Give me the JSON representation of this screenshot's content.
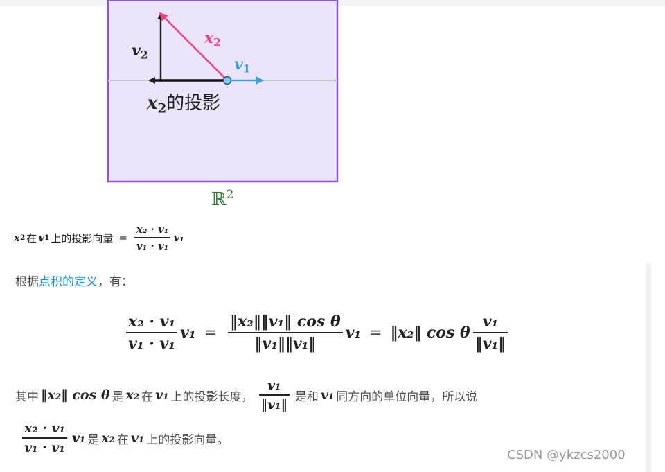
{
  "figure": {
    "label_v2_letter": "v",
    "label_v2_sub": "2",
    "label_x2_letter": "x",
    "label_x2_sub": "2",
    "label_v1_letter": "v",
    "label_v1_sub": "1",
    "proj_letter": "x",
    "proj_sub": "2",
    "proj_text": "的投影",
    "space_symbol": "ℝ",
    "space_sup": "2",
    "colors": {
      "panel_fill": "#ece4fb",
      "panel_border": "#9650e0",
      "x2_arrow": "#f0407a",
      "v1_arrow": "#3aa0d8",
      "axis": "#c8c8c8",
      "space_label": "#2e7d32"
    }
  },
  "definition": {
    "x": "x",
    "x_sub": "2",
    "in_text": "在",
    "v": "v",
    "v_sub": "1",
    "rest_text": "上的投影向量",
    "eq": "=",
    "num": "x₂ · v₁",
    "den": "v₁ · v₁",
    "tail": "v₁"
  },
  "para1": {
    "before": "根据",
    "link": "点积的定义",
    "after": "，有："
  },
  "display": {
    "frac1_num": "x₂ · v₁",
    "frac1_den": "v₁ · v₁",
    "tail1": "v₁",
    "eq1": "=",
    "frac2_num": "‖x₂‖‖v₁‖ cos θ",
    "frac2_den": "‖v₁‖‖v₁‖",
    "tail2": "v₁",
    "eq2": "=",
    "middle": "‖x₂‖ cos θ",
    "frac3_num": "v₁",
    "frac3_den": "‖v₁‖"
  },
  "para2": {
    "t1": "其中",
    "m1": "‖x₂‖ cos θ",
    "t2": "是",
    "m2": "x₂",
    "t3": "在",
    "m3": "v₁",
    "t4": "上的投影长度，",
    "f_num": "v₁",
    "f_den": "‖v₁‖",
    "t5": "是和",
    "m4": "v₁",
    "t6": "同方向的单位向量，所以说"
  },
  "para3": {
    "f_num": "x₂ · v₁",
    "f_den": "v₁ · v₁",
    "m1": "v₁",
    "t1": "是",
    "m2": "x₂",
    "t2": "在",
    "m3": "v₁",
    "t3": "上的投影向量。"
  },
  "watermark": "CSDN @ykzcs2000"
}
